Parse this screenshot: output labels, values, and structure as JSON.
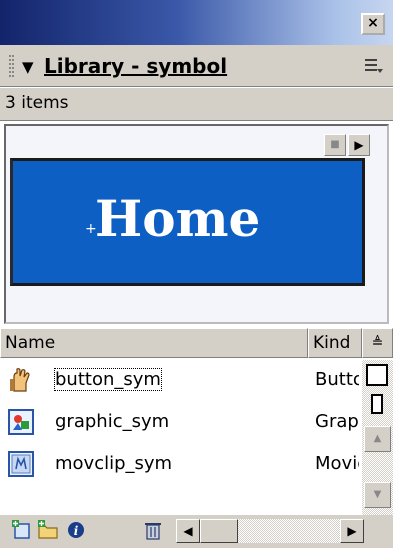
{
  "window": {
    "close_label": "×"
  },
  "panel": {
    "collapse_glyph": "▼",
    "title": "Library - symbol",
    "options_icon": "options-menu-icon"
  },
  "status": {
    "item_count": "3 items"
  },
  "preview": {
    "stop_glyph": "■",
    "play_glyph": "▶",
    "symbol_label": "Home",
    "symbol_fill": "#0d5fc4",
    "registration_glyph": "+"
  },
  "list": {
    "columns": [
      {
        "label": "Name"
      },
      {
        "label": "Kind"
      }
    ],
    "sort_glyph": "≜",
    "items": [
      {
        "name": "button_sym",
        "kind": "Button",
        "icon": "button-symbol-icon"
      },
      {
        "name": "graphic_sym",
        "kind": "Graphic",
        "icon": "graphic-symbol-icon"
      },
      {
        "name": "movclip_sym",
        "kind": "Movie Clip",
        "icon": "movieclip-symbol-icon"
      }
    ]
  },
  "scrollbar": {
    "up_glyph": "▲",
    "down_glyph": "▼",
    "left_glyph": "◀",
    "right_glyph": "▶"
  },
  "toolbar": {
    "icons": [
      "new-symbol-icon",
      "new-folder-icon",
      "properties-icon",
      "delete-icon"
    ]
  }
}
